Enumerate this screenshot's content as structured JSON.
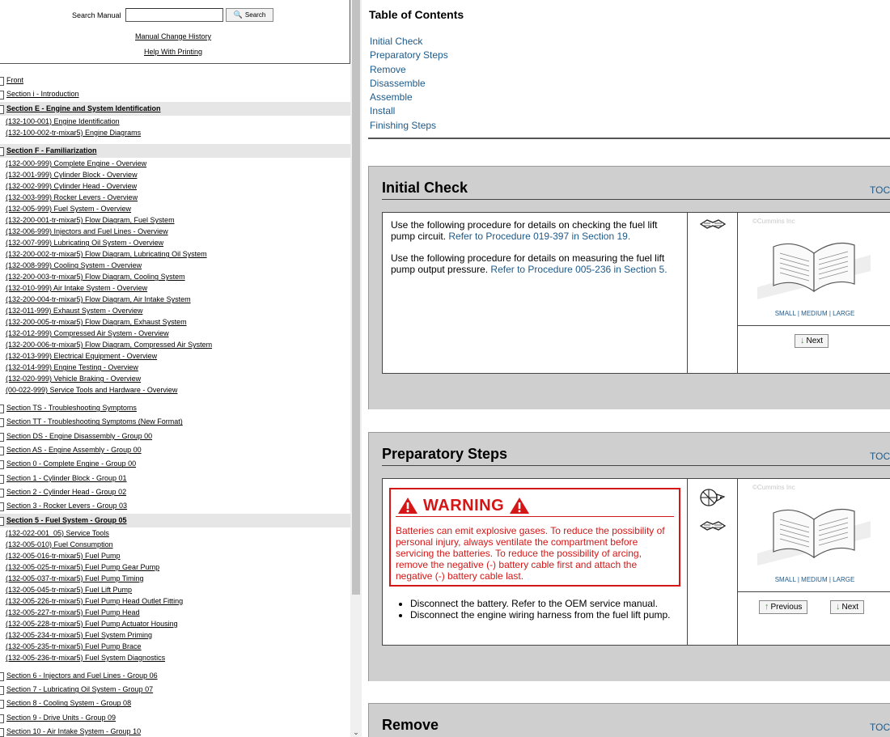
{
  "search": {
    "label": "Search Manual",
    "value": "",
    "button_label": "Search"
  },
  "links": {
    "manual_change_history": "Manual Change History",
    "help_printing": "Help With Printing"
  },
  "tree": [
    {
      "text": "Front",
      "kind": "sec"
    },
    {
      "text": "Section i - Introduction",
      "kind": "sec"
    },
    {
      "text": "Section E - Engine and System Identification",
      "kind": "sec-hl"
    },
    {
      "text": "(132-100-001) Engine Identification",
      "kind": "sub"
    },
    {
      "text": "(132-100-002-tr-mixar5) Engine Diagrams",
      "kind": "sub"
    },
    {
      "text": "",
      "kind": "gap"
    },
    {
      "text": "Section F - Familiarization",
      "kind": "sec-hl"
    },
    {
      "text": "(132-000-999) Complete Engine - Overview",
      "kind": "sub"
    },
    {
      "text": "(132-001-999) Cylinder Block - Overview",
      "kind": "sub"
    },
    {
      "text": "(132-002-999) Cylinder Head - Overview",
      "kind": "sub"
    },
    {
      "text": "(132-003-999) Rocker Levers - Overview",
      "kind": "sub"
    },
    {
      "text": "(132-005-999) Fuel System - Overview",
      "kind": "sub"
    },
    {
      "text": "(132-200-001-tr-mixar5) Flow Diagram, Fuel System",
      "kind": "sub"
    },
    {
      "text": "(132-006-999) Injectors and Fuel Lines - Overview",
      "kind": "sub"
    },
    {
      "text": "(132-007-999) Lubricating Oil System - Overview",
      "kind": "sub"
    },
    {
      "text": "(132-200-002-tr-mixar5) Flow Diagram, Lubricating Oil System",
      "kind": "sub"
    },
    {
      "text": "(132-008-999) Cooling System - Overview",
      "kind": "sub"
    },
    {
      "text": "(132-200-003-tr-mixar5) Flow Diagram, Cooling System",
      "kind": "sub"
    },
    {
      "text": "(132-010-999) Air Intake System - Overview",
      "kind": "sub"
    },
    {
      "text": "(132-200-004-tr-mixar5) Flow Diagram, Air Intake System",
      "kind": "sub"
    },
    {
      "text": "(132-011-999) Exhaust System - Overview",
      "kind": "sub"
    },
    {
      "text": "(132-200-005-tr-mixar5) Flow Diagram, Exhaust System",
      "kind": "sub"
    },
    {
      "text": "(132-012-999) Compressed Air System - Overview",
      "kind": "sub"
    },
    {
      "text": "(132-200-006-tr-mixar5) Flow Diagram, Compressed Air System",
      "kind": "sub"
    },
    {
      "text": "(132-013-999) Electrical Equipment - Overview",
      "kind": "sub"
    },
    {
      "text": "(132-014-999) Engine Testing - Overview",
      "kind": "sub"
    },
    {
      "text": "(132-020-999) Vehicle Braking - Overview",
      "kind": "sub"
    },
    {
      "text": "(00-022-999) Service Tools and Hardware - Overview",
      "kind": "sub"
    },
    {
      "text": "",
      "kind": "gap"
    },
    {
      "text": "Section TS - Troubleshooting Symptoms",
      "kind": "sec"
    },
    {
      "text": "Section TT - Troubleshooting Symptoms (New Format)",
      "kind": "sec"
    },
    {
      "text": "Section DS - Engine Disassembly - Group 00",
      "kind": "sec"
    },
    {
      "text": "Section AS - Engine Assembly - Group 00",
      "kind": "sec"
    },
    {
      "text": "Section 0 - Complete Engine - Group 00",
      "kind": "sec"
    },
    {
      "text": "Section 1 - Cylinder Block - Group 01",
      "kind": "sec"
    },
    {
      "text": "Section 2 - Cylinder Head - Group 02",
      "kind": "sec"
    },
    {
      "text": "Section 3 - Rocker Levers - Group 03",
      "kind": "sec"
    },
    {
      "text": "Section 5 - Fuel System - Group 05",
      "kind": "sec-hl"
    },
    {
      "text": "(132-022-001_05) Service Tools",
      "kind": "sub"
    },
    {
      "text": "(132-005-010) Fuel Consumption",
      "kind": "sub"
    },
    {
      "text": "(132-005-016-tr-mixar5) Fuel Pump",
      "kind": "sub"
    },
    {
      "text": "(132-005-025-tr-mixar5) Fuel Pump Gear Pump",
      "kind": "sub"
    },
    {
      "text": "(132-005-037-tr-mixar5) Fuel Pump Timing",
      "kind": "sub"
    },
    {
      "text": "(132-005-045-tr-mixar5) Fuel Lift Pump",
      "kind": "sub"
    },
    {
      "text": "(132-005-226-tr-mixar5) Fuel Pump Head Outlet Fitting",
      "kind": "sub"
    },
    {
      "text": "(132-005-227-tr-mixar5) Fuel Pump Head",
      "kind": "sub"
    },
    {
      "text": "(132-005-228-tr-mixar5) Fuel Pump Actuator Housing",
      "kind": "sub"
    },
    {
      "text": "(132-005-234-tr-mixar5) Fuel System Priming",
      "kind": "sub"
    },
    {
      "text": "(132-005-235-tr-mixar5) Fuel Pump Brace",
      "kind": "sub"
    },
    {
      "text": "(132-005-236-tr-mixar5) Fuel System Diagnostics",
      "kind": "sub"
    },
    {
      "text": "",
      "kind": "gap"
    },
    {
      "text": "Section 6 - Injectors and Fuel Lines - Group 06",
      "kind": "sec"
    },
    {
      "text": "Section 7 - Lubricating Oil System - Group 07",
      "kind": "sec"
    },
    {
      "text": "Section 8 - Cooling System - Group 08",
      "kind": "sec"
    },
    {
      "text": "Section 9 - Drive Units - Group 09",
      "kind": "sec"
    },
    {
      "text": "Section 10 - Air Intake System - Group 10",
      "kind": "sec"
    }
  ],
  "toc": {
    "title": "Table of Contents",
    "items": [
      "Initial Check",
      "Preparatory Steps",
      "Remove",
      "Disassemble",
      "Assemble",
      "Install",
      "Finishing Steps"
    ]
  },
  "sections": {
    "initial_check": {
      "title": "Initial Check",
      "toc_link": "TOC",
      "para1_text": "Use the following procedure for details on checking the fuel lift pump circuit. ",
      "para1_link": "Refer to Procedure 019-397 in Section 19.",
      "para2_text": "Use the following procedure for details on measuring the fuel lift pump output pressure. ",
      "para2_link": "Refer to Procedure 005-236 in Section 5.",
      "watermark": "©Cummins Inc",
      "size_small": "SMALL",
      "size_medium": "MEDIUM",
      "size_large": "LARGE",
      "next_label": "Next"
    },
    "preparatory_steps": {
      "title": "Preparatory Steps",
      "toc_link": "TOC",
      "warning_title": "WARNING",
      "warning_text": "Batteries can emit explosive gases. To reduce the possibility of personal injury, always ventilate the compartment before servicing the batteries. To reduce the possibility of arcing, remove the negative (-) battery cable first and attach the negative (-) battery cable last.",
      "bullets": [
        "Disconnect the battery. Refer to the OEM service manual.",
        "Disconnect the engine wiring harness from the fuel lift pump."
      ],
      "watermark": "©Cummins Inc",
      "size_small": "SMALL",
      "size_medium": "MEDIUM",
      "size_large": "LARGE",
      "previous_label": "Previous",
      "next_label": "Next"
    },
    "remove": {
      "title": "Remove",
      "toc_link": "TOC"
    }
  },
  "colors": {
    "link": "#1e5a8a",
    "warning": "#d41616",
    "panel_bg": "#cfcfcf",
    "row_highlight": "#e6e6e6"
  }
}
